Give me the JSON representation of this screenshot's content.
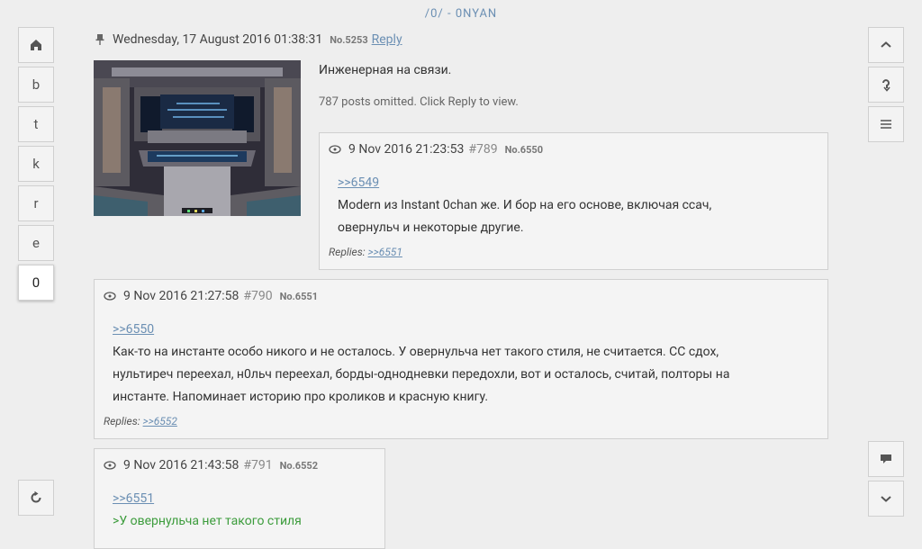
{
  "board_title": "/0/ - 0NYAN",
  "left_nav": {
    "home_icon": "home-icon",
    "boards": [
      "b",
      "t",
      "k",
      "r",
      "e",
      "0"
    ],
    "active_board": "0",
    "refresh_icon": "refresh-icon"
  },
  "right_nav": {
    "icons": [
      "chevron-up-icon",
      "return-icon",
      "menu-icon",
      "reply-pin-icon",
      "chevron-down-icon"
    ]
  },
  "op": {
    "date": "Wednesday, 17 August 2016 01:38:31",
    "no": "No.5253",
    "reply_label": "Reply",
    "text": "Инженерная на связи.",
    "omitted": "787 posts omitted. Click Reply to view."
  },
  "posts": [
    {
      "date": "9 Nov 2016 21:23:53",
      "num": "#789",
      "no": "No.6550",
      "ref": ">>6549",
      "lines": [
        "Modern из Instant 0chan же. И бор на его основе, включая ссач,",
        "овернульч и некоторые другие."
      ],
      "replies_label": "Replies:",
      "replies": ">>6551"
    },
    {
      "date": "9 Nov 2016 21:27:58",
      "num": "#790",
      "no": "No.6551",
      "ref": ">>6550",
      "lines": [
        "Как-то на инстанте особо никого и не осталось. У овернульча нет такого стиля, не считается. СС сдох,",
        "нультиреч переехал, н0льч переехал, борды-однодневки передохли, вот и осталось, считай, полторы на",
        "инстанте. Напоминает историю про кроликов и красную книгу."
      ],
      "replies_label": "Replies:",
      "replies": ">>6552"
    },
    {
      "date": "9 Nov 2016 21:43:58",
      "num": "#791",
      "no": "No.6552",
      "ref": ">>6551",
      "quote": ">У овернульча нет такого стиля"
    }
  ],
  "colors": {
    "link": "#6b8fb3",
    "quote": "#3c9c3c",
    "background": "#eeeeee"
  }
}
